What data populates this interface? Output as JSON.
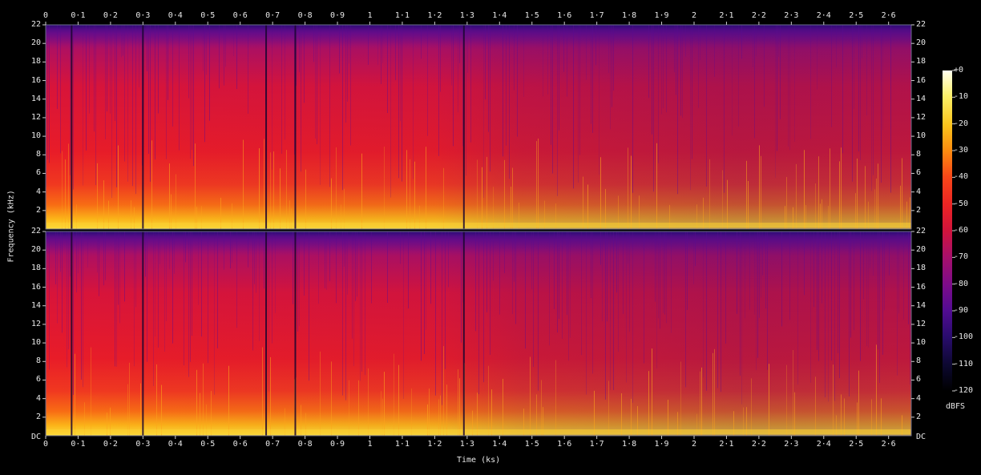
{
  "chart_data": {
    "type": "heatmap",
    "title": "",
    "xlabel": "Time (ks)",
    "ylabel": "Frequency (kHz)",
    "colorbar_label": "dBFS",
    "xlim": [
      0,
      2.67
    ],
    "ylim": [
      0,
      22
    ],
    "x_ticks": [
      "0",
      "0·1",
      "0·2",
      "0·3",
      "0·4",
      "0·5",
      "0·6",
      "0·7",
      "0·8",
      "0·9",
      "1",
      "1·1",
      "1·2",
      "1·3",
      "1·4",
      "1·5",
      "1·6",
      "1·7",
      "1·8",
      "1·9",
      "2",
      "2·1",
      "2·2",
      "2·3",
      "2·4",
      "2·5",
      "2·6"
    ],
    "y_ticks": [
      "22",
      "20",
      "18",
      "16",
      "14",
      "12",
      "10",
      "8",
      "6",
      "4",
      "2"
    ],
    "y_bottom_tick": "DC",
    "colorbar_ticks": [
      "+0",
      "-10",
      "-20",
      "-30",
      "-40",
      "-50",
      "-60",
      "-70",
      "-80",
      "-90",
      "-100",
      "-110",
      "-120"
    ],
    "channels": 2,
    "colormap": [
      "#000000",
      "#0c0830",
      "#2a0c6e",
      "#520c92",
      "#7c0c8a",
      "#a8106a",
      "#d0143c",
      "#ec2424",
      "#f84818",
      "#fc8c10",
      "#fcc41c",
      "#fcf068",
      "#fffff0"
    ],
    "dark_vertical_lines_ks": [
      0.08,
      0.3,
      0.68,
      0.77,
      1.29
    ],
    "description_levels": {
      "low_freq_band_dbfs": -20,
      "mid_band_dbfs": -55,
      "high_band_dbfs": -80
    }
  }
}
